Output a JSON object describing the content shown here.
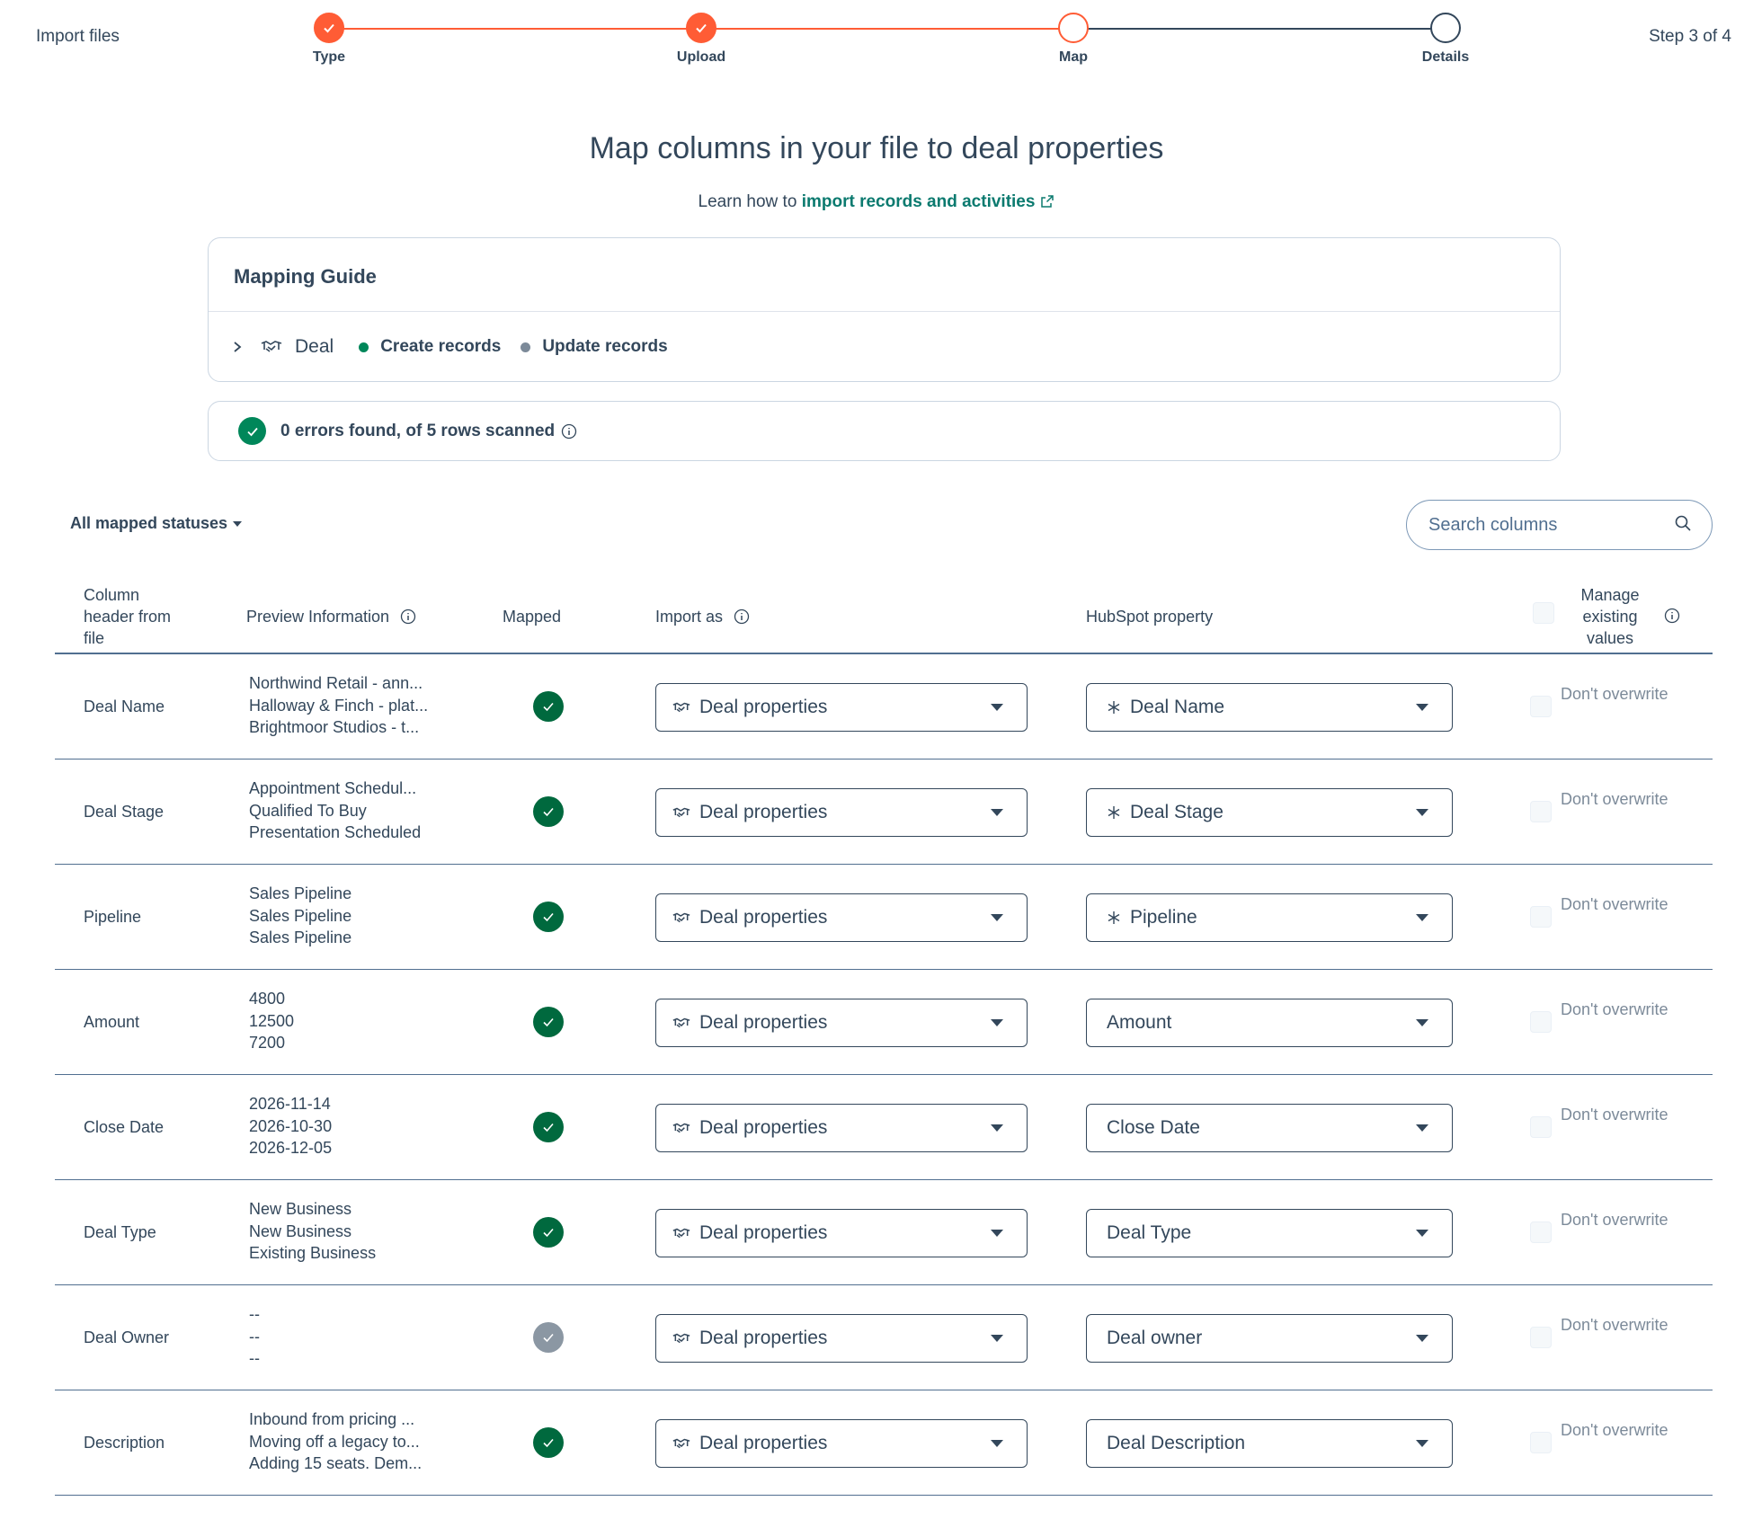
{
  "header": {
    "app_title": "Import files",
    "step_counter": "Step 3 of 4",
    "steps": [
      {
        "label": "Type",
        "status": "complete"
      },
      {
        "label": "Upload",
        "status": "complete"
      },
      {
        "label": "Map",
        "status": "current"
      },
      {
        "label": "Details",
        "status": "upcoming"
      }
    ]
  },
  "page": {
    "title": "Map columns in your file to deal properties",
    "learn_prefix": "Learn how to",
    "learn_link": "import records and activities"
  },
  "guide": {
    "title": "Mapping Guide",
    "object": "Deal",
    "create_label": "Create records",
    "update_label": "Update records"
  },
  "scan": {
    "message": "0 errors found, of 5 rows scanned"
  },
  "filters": {
    "status_filter": "All mapped statuses",
    "search_placeholder": "Search columns"
  },
  "table": {
    "headers": {
      "column_header": "Column header from file",
      "preview": "Preview Information",
      "mapped": "Mapped",
      "import_as": "Import as",
      "property": "HubSpot property",
      "manage": "Manage existing values"
    },
    "rows": [
      {
        "column": "Deal Name",
        "preview": [
          "Northwind Retail - ann...",
          "Halloway & Finch - plat...",
          "Brightmoor Studios - t..."
        ],
        "mapped": true,
        "import_as": "Deal properties",
        "property": "Deal Name",
        "required": true,
        "overwrite": "Don't overwrite"
      },
      {
        "column": "Deal Stage",
        "preview": [
          "Appointment Schedul...",
          "Qualified To Buy",
          "Presentation Scheduled"
        ],
        "mapped": true,
        "import_as": "Deal properties",
        "property": "Deal Stage",
        "required": true,
        "overwrite": "Don't overwrite"
      },
      {
        "column": "Pipeline",
        "preview": [
          "Sales Pipeline",
          "Sales Pipeline",
          "Sales Pipeline"
        ],
        "mapped": true,
        "import_as": "Deal properties",
        "property": "Pipeline",
        "required": true,
        "overwrite": "Don't overwrite"
      },
      {
        "column": "Amount",
        "preview": [
          "4800",
          "12500",
          "7200"
        ],
        "mapped": true,
        "import_as": "Deal properties",
        "property": "Amount",
        "required": false,
        "overwrite": "Don't overwrite"
      },
      {
        "column": "Close Date",
        "preview": [
          "2026-11-14",
          "2026-10-30",
          "2026-12-05"
        ],
        "mapped": true,
        "import_as": "Deal properties",
        "property": "Close Date",
        "required": false,
        "overwrite": "Don't overwrite"
      },
      {
        "column": "Deal Type",
        "preview": [
          "New Business",
          "New Business",
          "Existing Business"
        ],
        "mapped": true,
        "import_as": "Deal properties",
        "property": "Deal Type",
        "required": false,
        "overwrite": "Don't overwrite"
      },
      {
        "column": "Deal Owner",
        "preview": [
          "--",
          "--",
          "--"
        ],
        "mapped": false,
        "import_as": "Deal properties",
        "property": "Deal owner",
        "required": false,
        "overwrite": "Don't overwrite"
      },
      {
        "column": "Description",
        "preview": [
          "Inbound from pricing ...",
          "Moving off a legacy to...",
          "Adding 15 seats. Dem..."
        ],
        "mapped": true,
        "import_as": "Deal properties",
        "property": "Deal Description",
        "required": false,
        "overwrite": "Don't overwrite"
      }
    ]
  },
  "colors": {
    "accent": "#ff5c35",
    "success": "#00875a",
    "link": "#0b7a6f",
    "text": "#33475b"
  }
}
